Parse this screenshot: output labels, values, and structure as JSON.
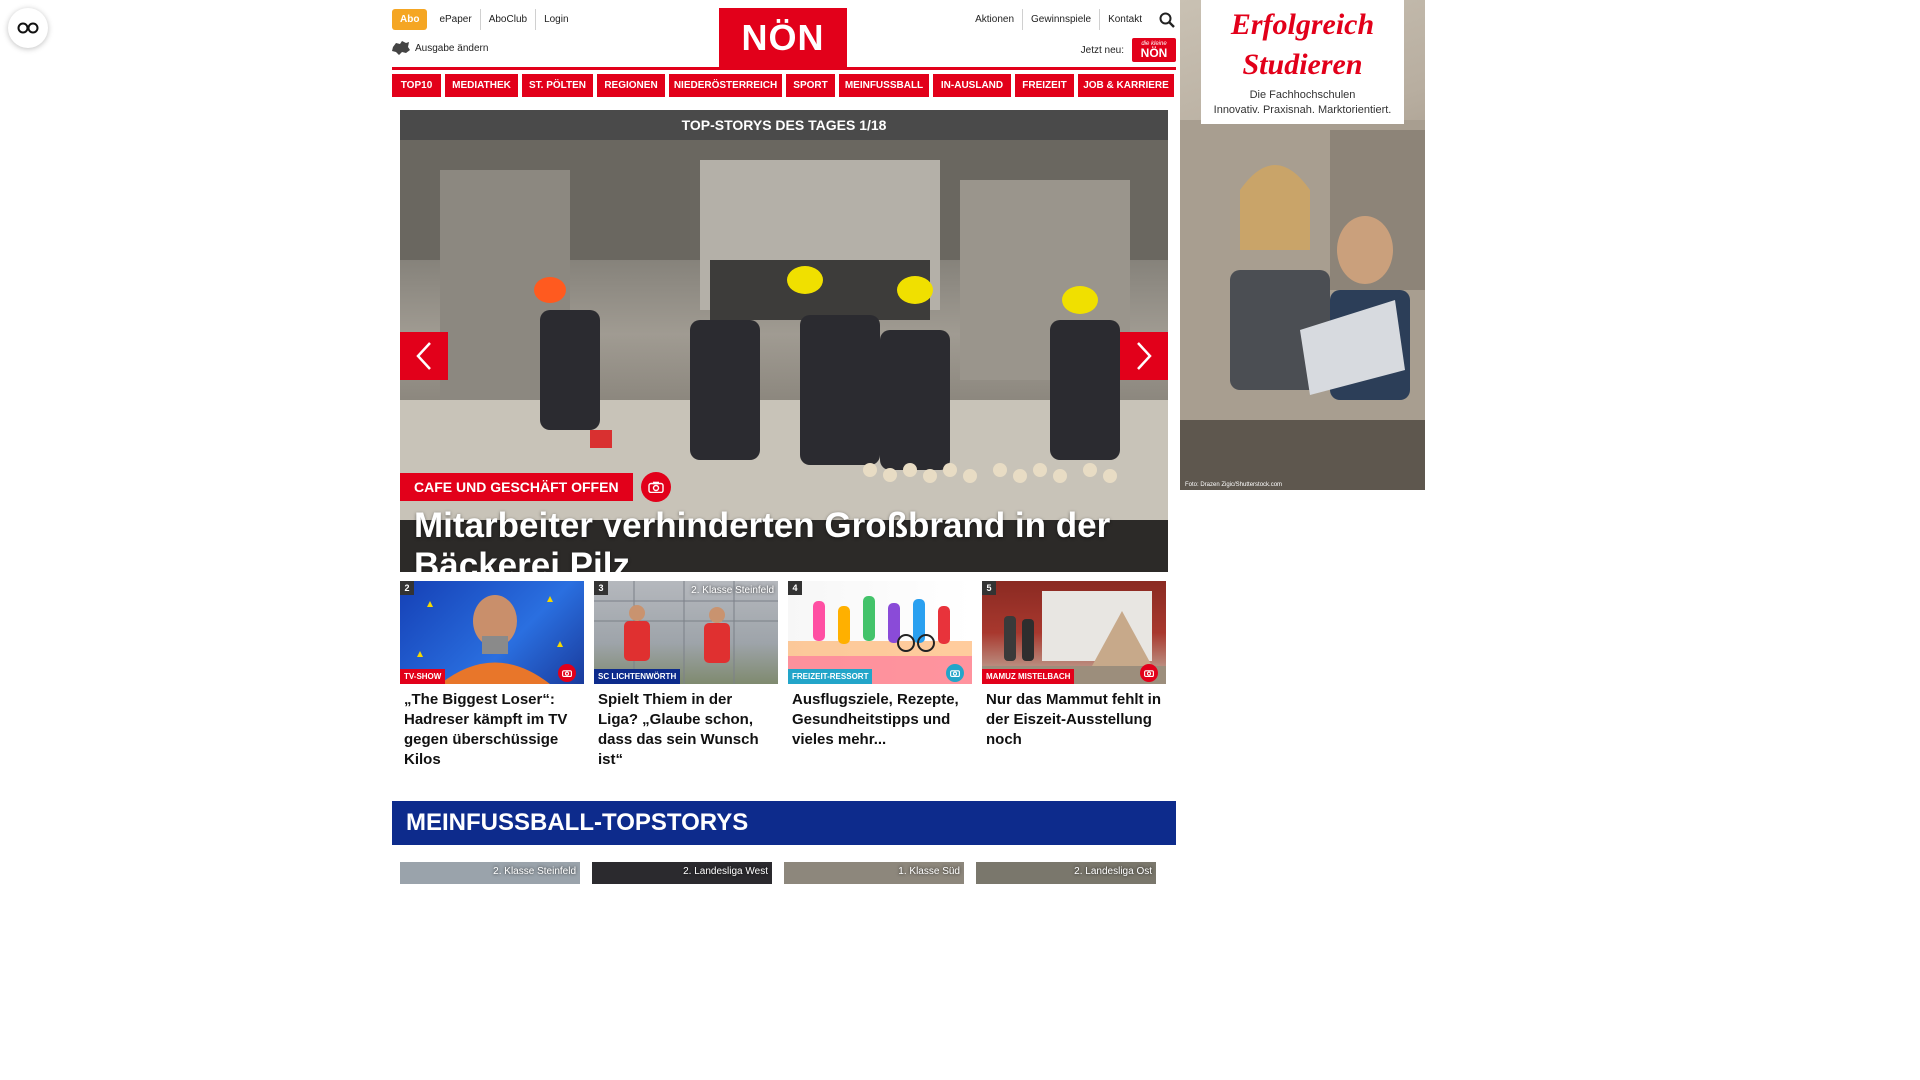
{
  "a11y": {
    "icon": "glasses-icon"
  },
  "header": {
    "abo": "Abo",
    "links_left": [
      "ePaper",
      "AboClub",
      "Login"
    ],
    "ausgabe": "Ausgabe ändern",
    "logo": "NÖN",
    "links_right": [
      "Aktionen",
      "Gewinnspiele",
      "Kontakt"
    ],
    "jetzt_neu": "Jetzt neu:",
    "mini_logo": "NÖN",
    "mini_logo_small": "die kleine"
  },
  "nav": [
    "TOP10",
    "MEDIATHEK",
    "ST. PÖLTEN",
    "REGIONEN",
    "NIEDERÖSTERREICH",
    "SPORT",
    "MEINFUSSBALL",
    "IN-AUSLAND",
    "FREIZEIT",
    "JOB & KARRIERE"
  ],
  "hero": {
    "header": "TOP-STORYS DES TAGES 1/18",
    "kicker": "CAFE UND GESCHÄFT OFFEN",
    "title": "Mitarbeiter verhinderten Großbrand in der Bäckerei Pilz"
  },
  "teasers": [
    {
      "num": "2",
      "tag": "TV-SHOW",
      "ribbon": "",
      "title": "„The Biggest Loser“: Hadreser kämpft im TV gegen überschüssige Kilos"
    },
    {
      "num": "3",
      "tag": "SC LICHTENWÖRTH",
      "ribbon": "2. Klasse Steinfeld",
      "title": "Spielt Thiem in der Liga? „Glaube schon, dass das sein Wunsch ist“"
    },
    {
      "num": "4",
      "tag": "FREIZEIT-RESSORT",
      "ribbon": "",
      "title": "Ausflugsziele, Rezepte, Gesundheitstipps und vieles mehr..."
    },
    {
      "num": "5",
      "tag": "MAMUZ MISTELBACH",
      "ribbon": "",
      "title": "Nur das Mammut fehlt in der Eiszeit-Ausstellung noch"
    }
  ],
  "section": {
    "title": "MEINFUSSBALL-TOPSTORYS",
    "thumbs": [
      "2. Klasse Steinfeld",
      "2. Landesliga West",
      "1. Klasse Süd",
      "2. Landesliga Ost"
    ]
  },
  "ad": {
    "headline_1": "Erfolgreich",
    "headline_2": "Studieren",
    "sub_1": "Die Fachhochschulen",
    "sub_2": "Innovativ. Praxisnah. Marktorientiert.",
    "credit": "Foto: Drazen Zigic/Shutterstock.com"
  },
  "colors": {
    "brand_red": "#e2001a",
    "abo_orange": "#f5a623",
    "section_blue": "#0d2b8c",
    "teal": "#22a5c9"
  }
}
